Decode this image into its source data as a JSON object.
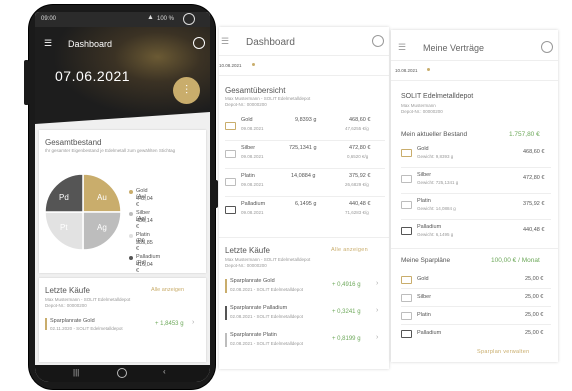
{
  "phone": {
    "status": {
      "time": "09:00",
      "battery": "100 %"
    },
    "header_title": "Dashboard",
    "date": "07.06.2021",
    "bestand": {
      "title": "Gesamtbestand",
      "subtitle": "Ihr gesamter Eigenbestand je Edelmetall zum gewählten Stichtag",
      "pie_labels": [
        "Au",
        "Pd",
        "Pt",
        "Ag"
      ],
      "legend": [
        {
          "name": "Gold (Au)",
          "value": "442,04 €",
          "color": "#c9ad6c"
        },
        {
          "name": "Silber (Ag)",
          "value": "480,14 €",
          "color": "#bdbdbd"
        },
        {
          "name": "Platin (Pt)",
          "value": "385,85 €",
          "color": "#e0e0e0"
        },
        {
          "name": "Palladium (Pd)",
          "value": "416,04 €",
          "color": "#555555"
        }
      ]
    },
    "kaeufe": {
      "title": "Letzte Käufe",
      "link": "Alle anzeigen",
      "sub1": "Max Mustermann - SOLIT Edelmetalldepot",
      "sub2": "Depot-Nr.: 00000200",
      "item": {
        "name": "Sparplanrate Gold",
        "meta": "02.11.2020 - SOLIT Edelmetalldepot",
        "amount": "+ 1,8453 g"
      }
    }
  },
  "screen2": {
    "header_title": "Dashboard",
    "date": "10.08.2021",
    "overview": {
      "title": "Gesamtübersicht",
      "sub1": "Max Mustermann - SOLIT Edelmetalldepot",
      "sub2": "Depot-Nr.: 00000200",
      "rows": [
        {
          "name": "Gold",
          "date": "09.08.2021",
          "grams": "9,8393 g",
          "value": "468,60 €",
          "price": "47,6255 €/g"
        },
        {
          "name": "Silber",
          "date": "09.08.2021",
          "grams": "725,1341 g",
          "value": "472,80 €",
          "price": "0,6520 €/g"
        },
        {
          "name": "Platin",
          "date": "09.08.2021",
          "grams": "14,0884 g",
          "value": "375,92 €",
          "price": "26,6829 €/g"
        },
        {
          "name": "Palladium",
          "date": "09.08.2021",
          "grams": "6,1495 g",
          "value": "440,48 €",
          "price": "71,6283 €/g"
        }
      ]
    },
    "kaeufe": {
      "title": "Letzte Käufe",
      "link": "Alle anzeigen",
      "sub1": "Max Mustermann - SOLIT Edelmetalldepot",
      "sub2": "Depot-Nr.: 00000200",
      "items": [
        {
          "name": "Sparplanrate Gold",
          "meta": "02.08.2021 - SOLIT Edelmetalldepot",
          "amount": "+ 0,4916 g",
          "accent": "#c9ad6c"
        },
        {
          "name": "Sparplanrate Palladium",
          "meta": "02.08.2021 - SOLIT Edelmetalldepot",
          "amount": "+ 0,3241 g",
          "accent": "#555555"
        },
        {
          "name": "Sparplanrate Platin",
          "meta": "02.08.2021 - SOLIT Edelmetalldepot",
          "amount": "+ 0,8199 g",
          "accent": "#bdbdbd"
        }
      ]
    }
  },
  "screen3": {
    "header_title": "Meine Verträge",
    "date": "10.08.2021",
    "depot": {
      "title": "SOLIT Edelmetalldepot",
      "sub1": "Max Mustermann",
      "sub2": "Depot-Nr.: 00000200"
    },
    "bestand": {
      "title": "Mein aktueller Bestand",
      "total": "1.757,80 €",
      "rows": [
        {
          "name": "Gold",
          "weight": "Gewicht: 9,8393 g",
          "value": "468,60 €"
        },
        {
          "name": "Silber",
          "weight": "Gewicht: 725,1341 g",
          "value": "472,80 €"
        },
        {
          "name": "Platin",
          "weight": "Gewicht: 14,0884 g",
          "value": "375,92 €"
        },
        {
          "name": "Palladium",
          "weight": "Gewicht: 6,1495 g",
          "value": "440,48 €"
        }
      ]
    },
    "sparplaene": {
      "title": "Meine Sparpläne",
      "total": "100,00 € / Monat",
      "rows": [
        {
          "name": "Gold",
          "value": "25,00 €"
        },
        {
          "name": "Silber",
          "value": "25,00 €"
        },
        {
          "name": "Platin",
          "value": "25,00 €"
        },
        {
          "name": "Palladium",
          "value": "25,00 €"
        }
      ],
      "link": "Sparplan verwalten"
    }
  }
}
